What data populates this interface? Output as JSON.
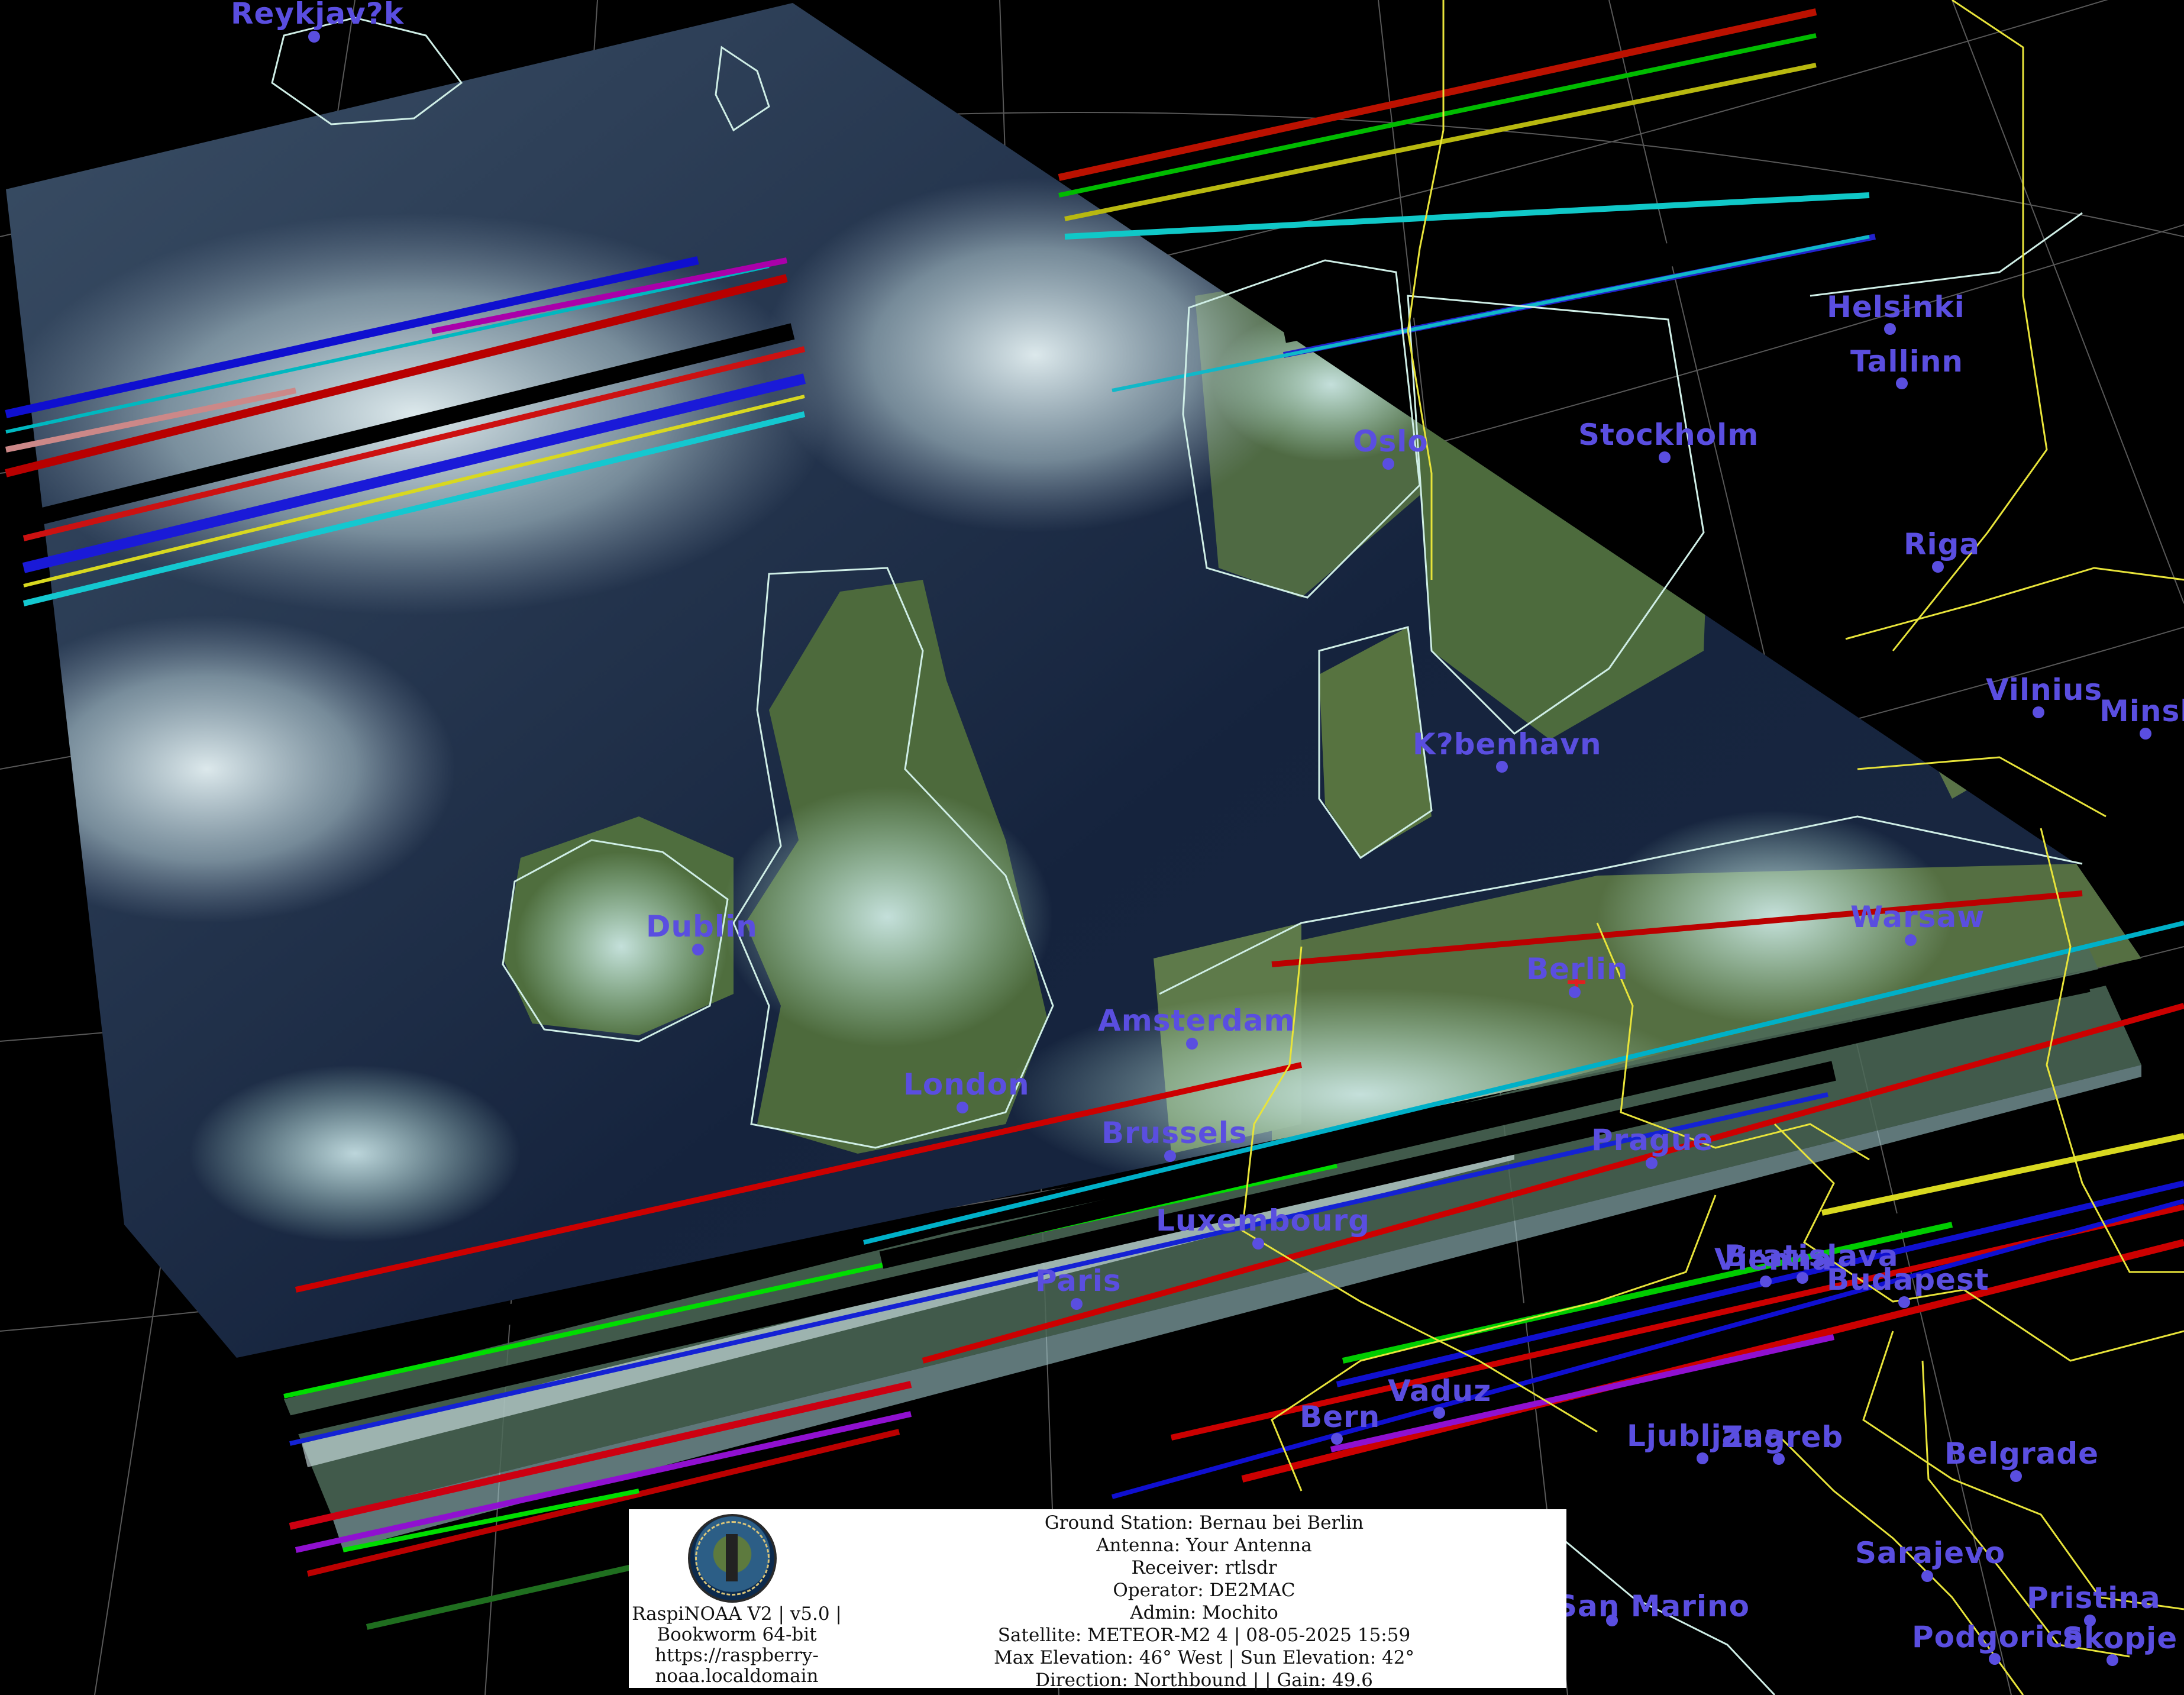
{
  "colors": {
    "background": "#000000",
    "city_label": "#5a4ee0",
    "coastline": "#cfeee6",
    "border": "#e8e43a",
    "grid": "#6f6f6f",
    "ground_station_marker": "#e02020"
  },
  "cities": [
    {
      "name": "Reykjav?k",
      "dot": true
    },
    {
      "name": "Helsinki",
      "dot": true
    },
    {
      "name": "Tallinn",
      "dot": true
    },
    {
      "name": "Oslo",
      "dot": true
    },
    {
      "name": "Stockholm",
      "dot": true
    },
    {
      "name": "Riga",
      "dot": true
    },
    {
      "name": "Vilnius",
      "dot": true
    },
    {
      "name": "Minsk",
      "dot": true
    },
    {
      "name": "K?benhavn",
      "dot": true
    },
    {
      "name": "Dublin",
      "dot": true
    },
    {
      "name": "Warsaw",
      "dot": true
    },
    {
      "name": "Berlin",
      "dot": true
    },
    {
      "name": "Amsterdam",
      "dot": true
    },
    {
      "name": "London",
      "dot": true
    },
    {
      "name": "Brussels",
      "dot": true
    },
    {
      "name": "Prague",
      "dot": true
    },
    {
      "name": "Luxembourg",
      "dot": true
    },
    {
      "name": "Paris",
      "dot": true
    },
    {
      "name": "Vienna",
      "dot": true
    },
    {
      "name": "Bratislava",
      "dot": true
    },
    {
      "name": "Budapest",
      "dot": true
    },
    {
      "name": "Vaduz",
      "dot": true
    },
    {
      "name": "Bern",
      "dot": true
    },
    {
      "name": "Ljubljana",
      "dot": true
    },
    {
      "name": "Zagreb",
      "dot": true
    },
    {
      "name": "Belgrade",
      "dot": true
    },
    {
      "name": "Sarajevo",
      "dot": true
    },
    {
      "name": "San Marino",
      "dot": true
    },
    {
      "name": "Pristina",
      "dot": true
    },
    {
      "name": "Podgorica",
      "dot": true
    },
    {
      "name": "Skopje",
      "dot": true
    }
  ],
  "info_box": {
    "left_lines": [
      "RaspiNOAA V2 | v5.0 |",
      "Bookworm 64-bit",
      "https://raspberry-",
      "noaa.localdomain"
    ],
    "right_lines": [
      "Ground Station: Bernau bei Berlin",
      "Antenna: Your Antenna",
      "Receiver: rtlsdr",
      "Operator: DE2MAC",
      "Admin: Mochito",
      "Satellite: METEOR-M2 4 | 08-05-2025 15:59",
      "Max Elevation: 46° West | Sun Elevation: 42°",
      "Direction: Northbound | | Gain: 49.6"
    ]
  }
}
